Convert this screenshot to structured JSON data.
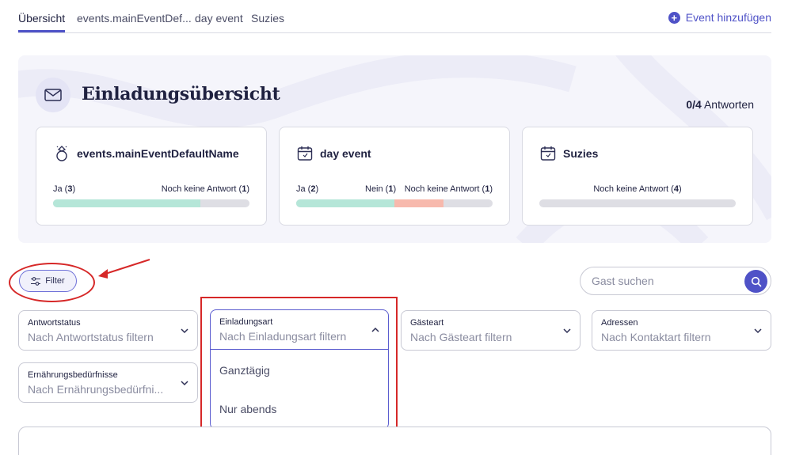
{
  "tabs": [
    {
      "label": "Übersicht",
      "active": true
    },
    {
      "label": "events.mainEventDef..."
    },
    {
      "label": "day event"
    },
    {
      "label": "Suzies"
    }
  ],
  "add_event_label": "Event hinzufügen",
  "overview": {
    "title": "Einladungsübersicht",
    "responses_count": "0/4",
    "responses_label": "Antworten"
  },
  "events": [
    {
      "name": "events.mainEventDefaultName",
      "icon": "ring-icon",
      "stats": [
        {
          "label": "Ja",
          "count": "3"
        },
        {
          "label": "Noch keine Antwort",
          "count": "1"
        }
      ],
      "fractions": {
        "ja": 0.75,
        "nein": 0,
        "none": 0.25
      }
    },
    {
      "name": "day event",
      "icon": "calendar-icon",
      "stats": [
        {
          "label": "Ja",
          "count": "2"
        },
        {
          "label": "Nein",
          "count": "1"
        },
        {
          "label": "Noch keine Antwort",
          "count": "1"
        }
      ],
      "fractions": {
        "ja": 0.5,
        "nein": 0.25,
        "none": 0.25
      }
    },
    {
      "name": "Suzies",
      "icon": "calendar-icon",
      "stats": [
        {
          "label": "Noch keine Antwort",
          "count": "4"
        }
      ],
      "fractions": {
        "ja": 0,
        "nein": 0,
        "none": 1
      }
    }
  ],
  "filter_button": "Filter",
  "search": {
    "placeholder": "Gast suchen"
  },
  "filters": [
    {
      "label": "Antwortstatus",
      "placeholder": "Nach Antwortstatus filtern"
    },
    {
      "label": "Einladungsart",
      "placeholder": "Nach Einladungsart filtern",
      "open": true
    },
    {
      "label": "Gästeart",
      "placeholder": "Nach Gästeart filtern"
    },
    {
      "label": "Adressen",
      "placeholder": "Nach Kontaktart filtern"
    },
    {
      "label": "Ernährungsbedürfnisse",
      "placeholder": "Nach Ernährungsbedürfni..."
    }
  ],
  "dropdown_options": [
    "Ganztägig",
    "Nur abends"
  ],
  "colors": {
    "accent": "#4f52c7",
    "ja": "#b5e6d8",
    "nein": "#f7b9ad",
    "none": "#dedee4",
    "annotation": "#d62828"
  }
}
